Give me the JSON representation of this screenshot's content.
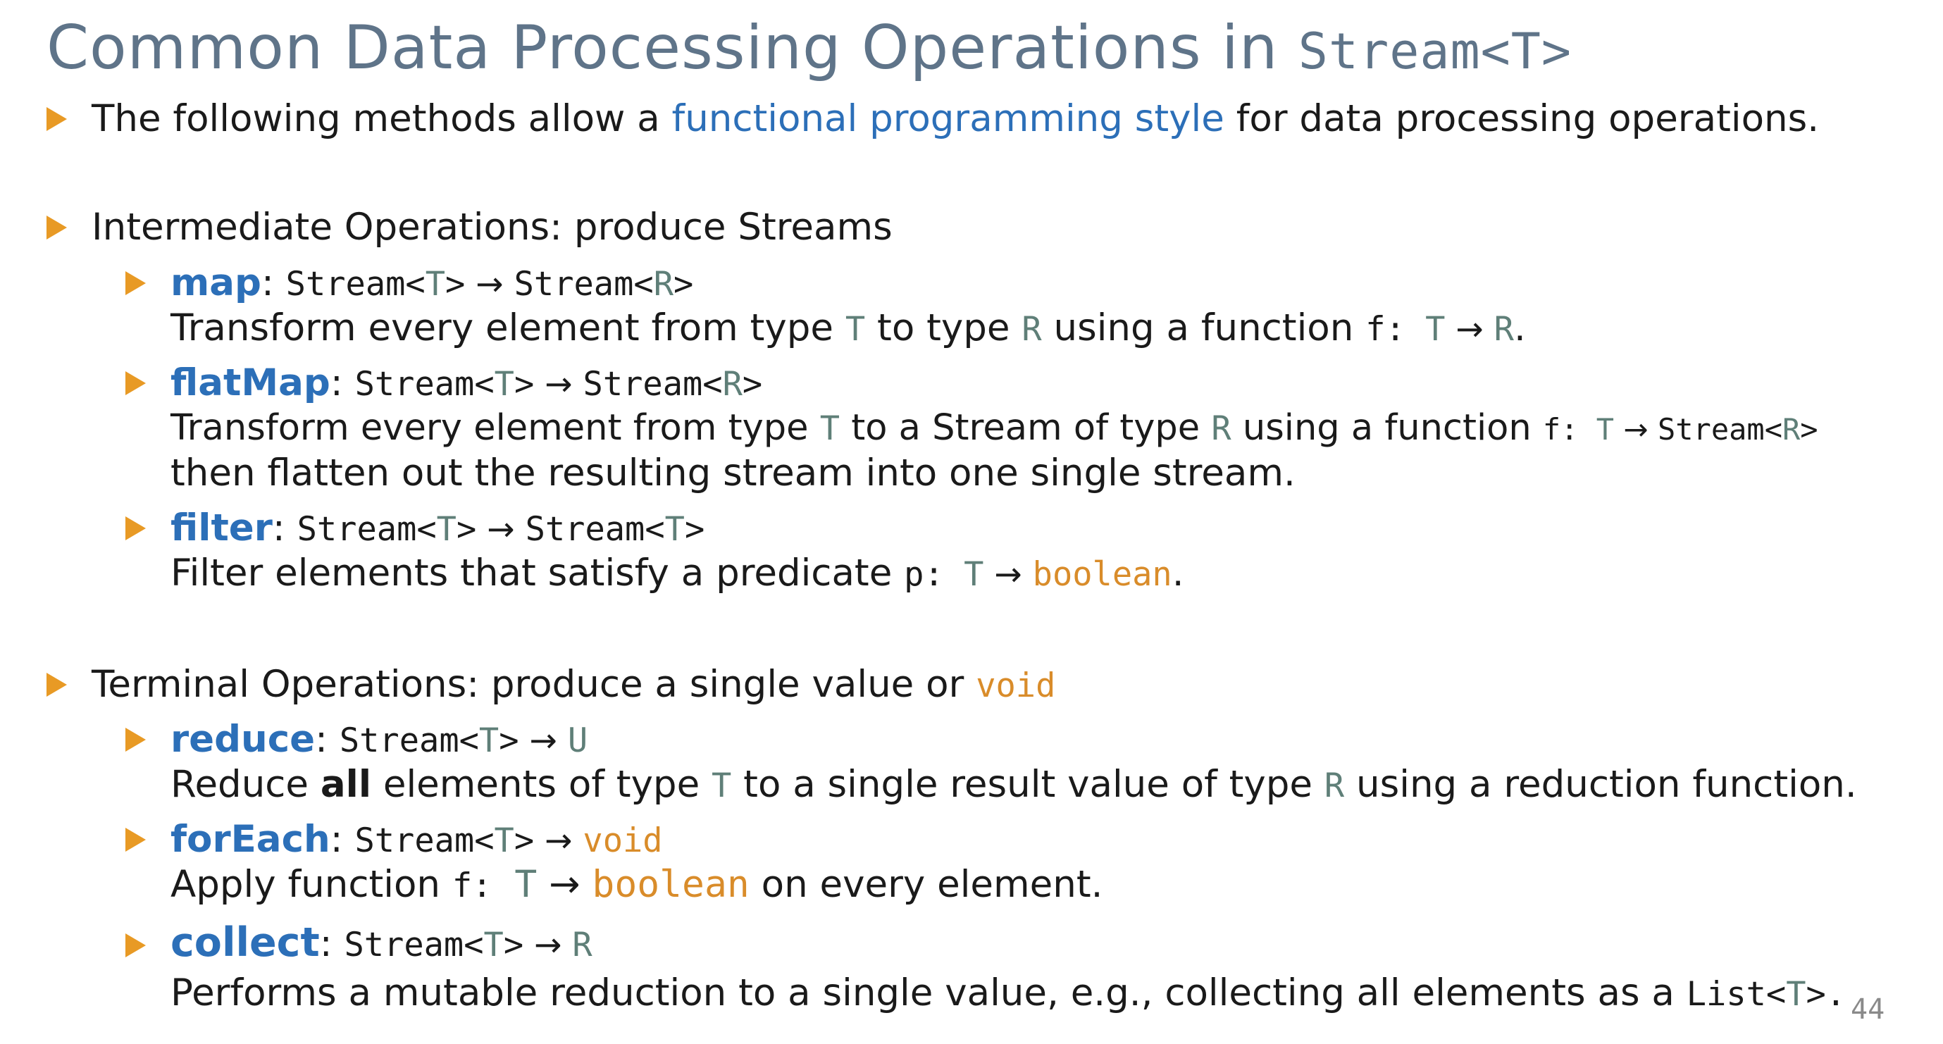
{
  "title": {
    "prefix": "Common Data Processing Operations in ",
    "code": "Stream<T>"
  },
  "intro": {
    "before": "The following methods allow a ",
    "highlight": "functional programming style",
    "after": " for data processing operations."
  },
  "intermediate": {
    "heading": "Intermediate Operations: produce Streams",
    "map": {
      "name": "map",
      "sig_in": "Stream<",
      "sig_in_type": "T",
      "sig_close": ">",
      "arrow": "→",
      "sig_out": "Stream<",
      "sig_out_type": "R",
      "desc_a": "Transform every element from type ",
      "t": "T",
      "desc_b": " to type ",
      "r": "R",
      "desc_c": " using a function ",
      "f": "f:",
      "end": "."
    },
    "flatMap": {
      "name": "flatMap",
      "sig_in": "Stream<",
      "sig_in_type": "T",
      "sig_close": ">",
      "arrow": "→",
      "sig_out": "Stream<",
      "sig_out_type": "R",
      "desc_a": "Transform every element from type ",
      "t": "T",
      "desc_b": " to a Stream of type ",
      "r": "R",
      "desc_c": " using a function ",
      "f": "f:",
      "stream": "Stream<",
      "desc2": "then flatten out the resulting stream into one single stream."
    },
    "filter": {
      "name": "filter",
      "sig_in": "Stream<",
      "sig_in_type": "T",
      "sig_close": ">",
      "arrow": "→",
      "sig_out": "Stream<",
      "sig_out_type": "T",
      "desc_a": "Filter elements that satisfy a predicate ",
      "p": "p:",
      "t": "T",
      "boolean": "boolean",
      "end": "."
    }
  },
  "terminal": {
    "heading": "Terminal Operations: produce a single value or ",
    "heading_kw": "void",
    "reduce": {
      "name": "reduce",
      "sig_in": "Stream<",
      "sig_in_type": "T",
      "sig_close": ">",
      "arrow": "→",
      "sig_out": "U",
      "desc_a": "Reduce ",
      "all": "all",
      "desc_b": " elements of type ",
      "t": "T",
      "desc_c": " to a single result value of type ",
      "r": "R",
      "desc_d": " using a reduction function."
    },
    "forEach": {
      "name": "forEach",
      "sig_in": "Stream<",
      "sig_in_type": "T",
      "sig_close": ">",
      "arrow": "→",
      "sig_out": "void",
      "desc_a": "Apply function ",
      "f": "f:",
      "t": "T",
      "boolean": "boolean",
      "desc_b": " on every element."
    },
    "collect": {
      "name": "collect",
      "sig_in": "Stream<",
      "sig_in_type": "T",
      "sig_close": ">",
      "arrow": "→",
      "sig_out": "R",
      "desc_a": "Performs a mutable reduction to a single value, e.g., collecting all elements as a ",
      "list": "List<",
      "t": "T",
      "end": ">."
    }
  },
  "page_number": "44"
}
